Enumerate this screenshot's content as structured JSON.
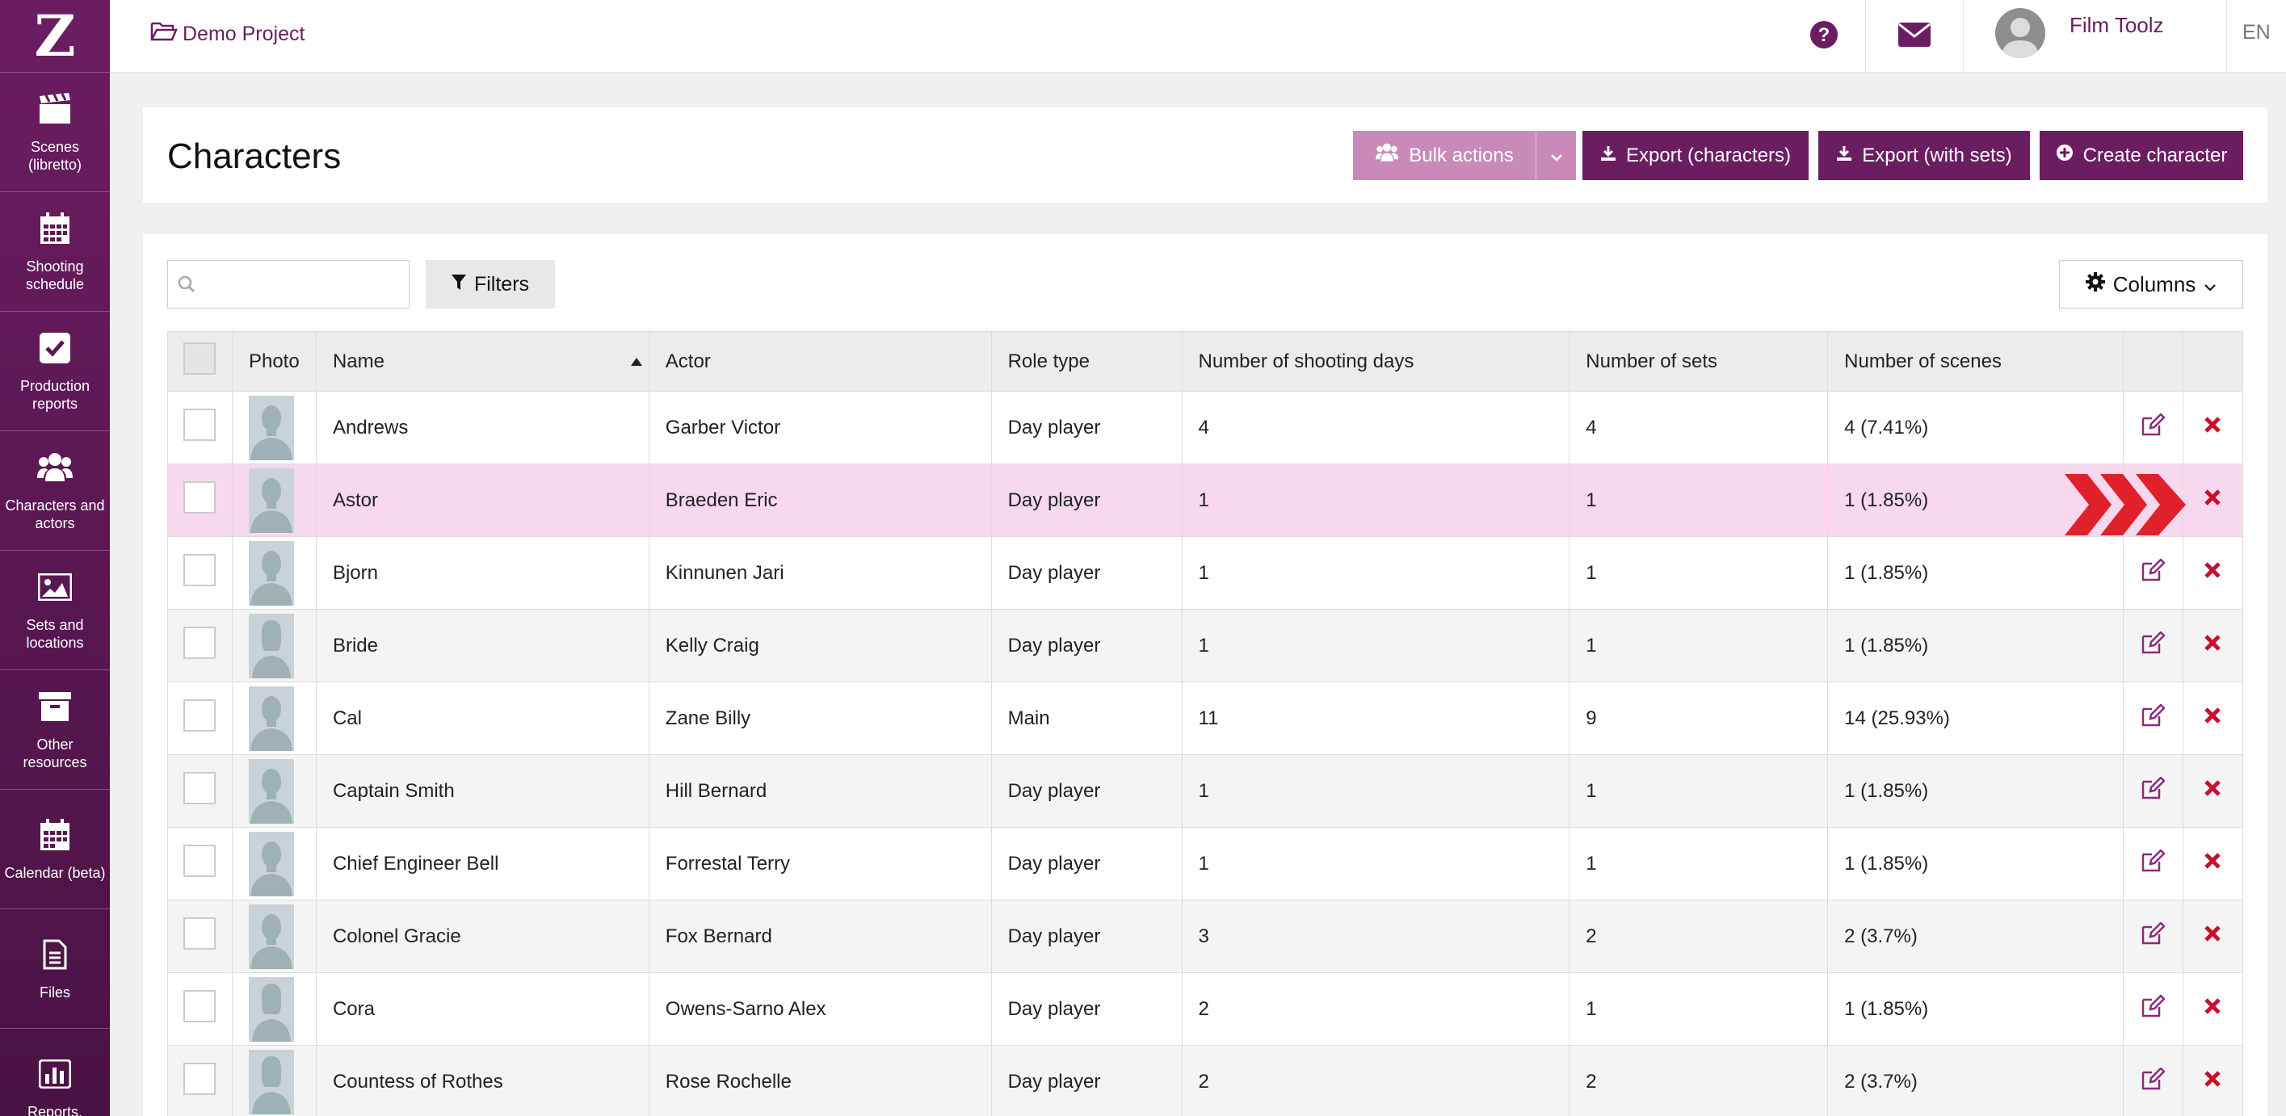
{
  "sidebar": {
    "logo": "Z",
    "items": [
      {
        "label": "Scenes (libretto)",
        "icon": "clapperboard-icon"
      },
      {
        "label": "Shooting schedule",
        "icon": "calendar-icon"
      },
      {
        "label": "Production reports",
        "icon": "checkbox-icon"
      },
      {
        "label": "Characters and actors",
        "icon": "users-icon"
      },
      {
        "label": "Sets and locations",
        "icon": "image-icon"
      },
      {
        "label": "Other resources",
        "icon": "archive-icon"
      },
      {
        "label": "Calendar (beta)",
        "icon": "calendar-grid-icon"
      },
      {
        "label": "Files",
        "icon": "file-icon"
      },
      {
        "label": "Reports,",
        "icon": "bar-chart-icon"
      }
    ]
  },
  "topbar": {
    "project": "Demo Project",
    "user_name": "Film Toolz",
    "language": "EN"
  },
  "header": {
    "title": "Characters",
    "bulk_actions": "Bulk actions",
    "export_characters": "Export (characters)",
    "export_with_sets": "Export (with sets)",
    "create_character": "Create character"
  },
  "toolbar": {
    "search_placeholder": "",
    "filters": "Filters",
    "columns": "Columns"
  },
  "table": {
    "columns": {
      "photo": "Photo",
      "name": "Name",
      "actor": "Actor",
      "role": "Role type",
      "days": "Number of shooting days",
      "sets": "Number of sets",
      "scenes": "Number of scenes"
    },
    "rows": [
      {
        "name": "Andrews",
        "actor": "Garber Victor",
        "role": "Day player",
        "days": "4",
        "sets": "4",
        "scenes": "4 (7.41%)"
      },
      {
        "name": "Astor",
        "actor": "Braeden Eric",
        "role": "Day player",
        "days": "1",
        "sets": "1",
        "scenes": "1 (1.85%)"
      },
      {
        "name": "Bjorn",
        "actor": "Kinnunen Jari",
        "role": "Day player",
        "days": "1",
        "sets": "1",
        "scenes": "1 (1.85%)"
      },
      {
        "name": "Bride",
        "actor": "Kelly Craig",
        "role": "Day player",
        "days": "1",
        "sets": "1",
        "scenes": "1 (1.85%)"
      },
      {
        "name": "Cal",
        "actor": "Zane Billy",
        "role": "Main",
        "days": "11",
        "sets": "9",
        "scenes": "14 (25.93%)"
      },
      {
        "name": "Captain Smith",
        "actor": "Hill Bernard",
        "role": "Day player",
        "days": "1",
        "sets": "1",
        "scenes": "1 (1.85%)"
      },
      {
        "name": "Chief Engineer Bell",
        "actor": "Forrestal Terry",
        "role": "Day player",
        "days": "1",
        "sets": "1",
        "scenes": "1 (1.85%)"
      },
      {
        "name": "Colonel Gracie",
        "actor": "Fox Bernard",
        "role": "Day player",
        "days": "3",
        "sets": "2",
        "scenes": "2 (3.7%)"
      },
      {
        "name": "Cora",
        "actor": "Owens-Sarno Alex",
        "role": "Day player",
        "days": "2",
        "sets": "1",
        "scenes": "1 (1.85%)"
      },
      {
        "name": "Countess of Rothes",
        "actor": "Rose Rochelle",
        "role": "Day player",
        "days": "2",
        "sets": "2",
        "scenes": "2 (3.7%)"
      }
    ]
  },
  "colors": {
    "brand": "#6b1d62",
    "brand_muted": "#c98ab9",
    "highlight_row": "#f7d8ee",
    "delete": "#c8102e",
    "pointer_arrows": "#e0202a"
  }
}
